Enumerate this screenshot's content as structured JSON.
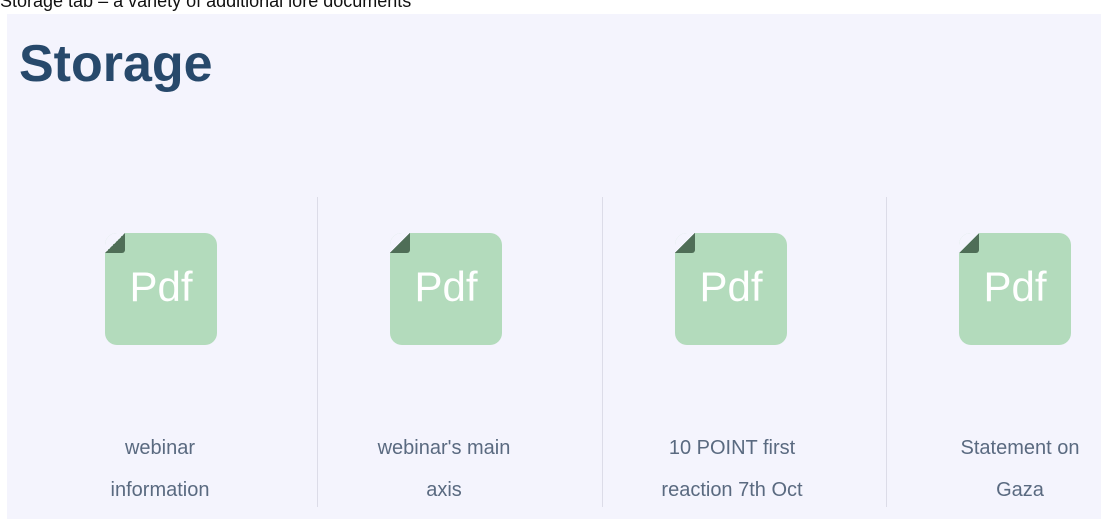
{
  "caption": "Storage tab – a variety of additional lore documents",
  "title": "Storage",
  "colors": {
    "panel_background": "#f4f4fd",
    "title": "#27496b",
    "pdf_icon": "#b3dbbc",
    "file_name": "#5a6a80"
  },
  "files": [
    {
      "icon": "pdf-file-icon",
      "icon_label": "Pdf",
      "name": "webinar information"
    },
    {
      "icon": "pdf-file-icon",
      "icon_label": "Pdf",
      "name": "webinar's main axis"
    },
    {
      "icon": "pdf-file-icon",
      "icon_label": "Pdf",
      "name": "10 POINT first reaction 7th Oct"
    },
    {
      "icon": "pdf-file-icon",
      "icon_label": "Pdf",
      "name": "Statement on Gaza"
    }
  ]
}
